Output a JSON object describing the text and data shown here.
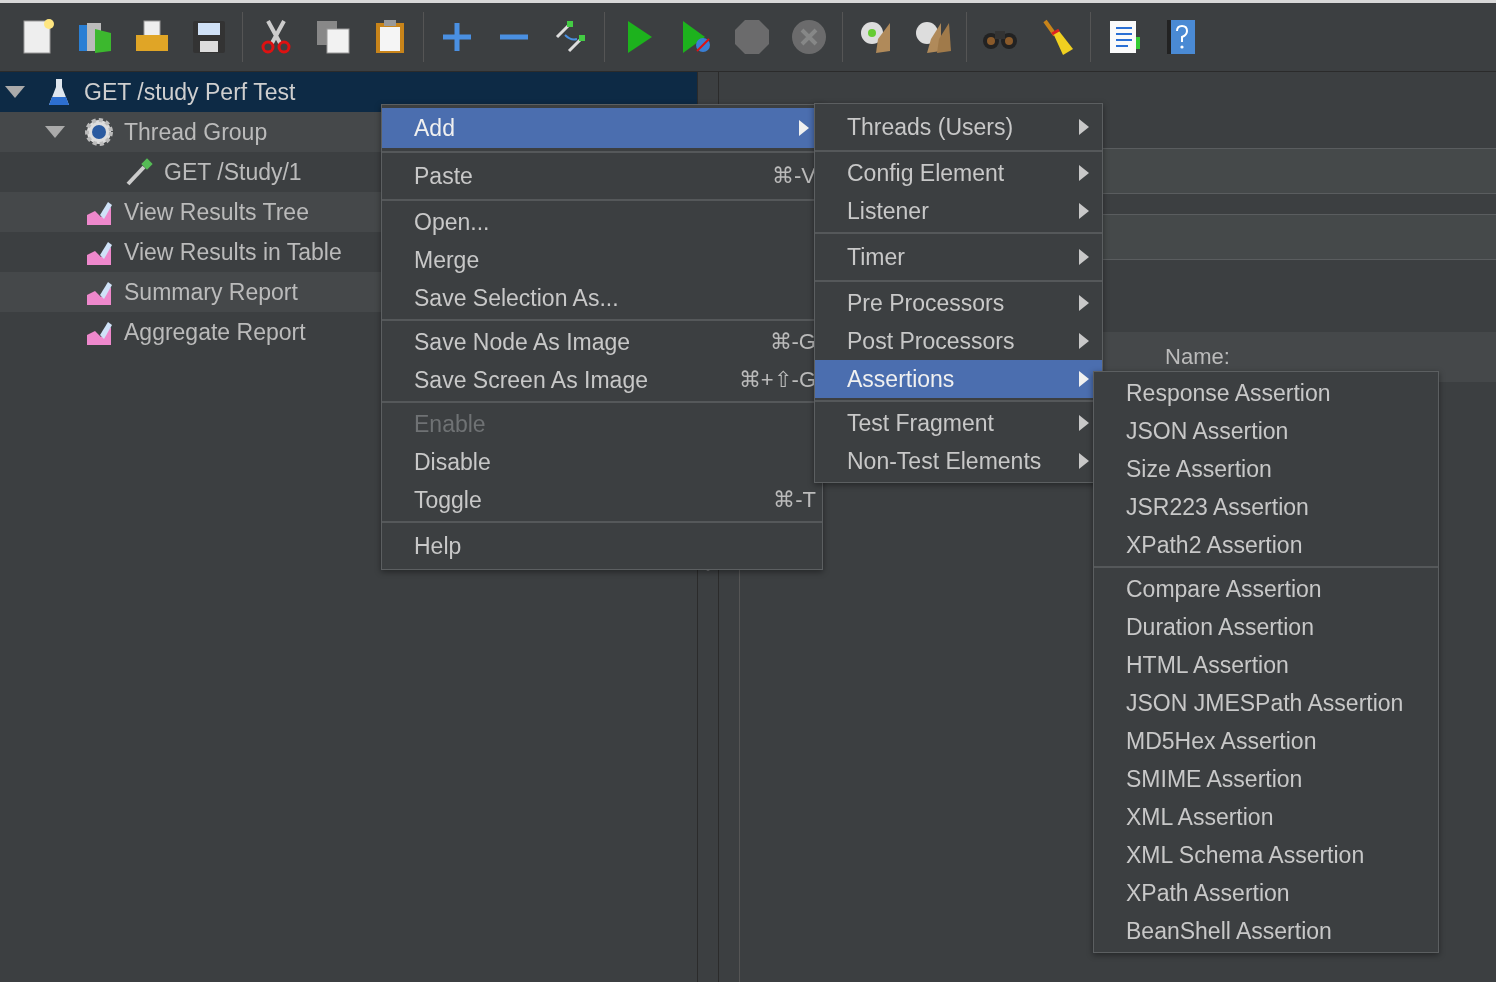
{
  "tree": [
    {
      "label": "GET /study Perf Test",
      "kind": "plan",
      "selected": true,
      "expanded": true,
      "children": [
        {
          "label": "Thread Group",
          "kind": "thread-group",
          "selected": false,
          "expanded": true,
          "children": [
            {
              "label": "GET /Study/1",
              "kind": "sampler",
              "selected": false
            }
          ]
        },
        {
          "label": "View Results Tree",
          "kind": "listener",
          "selected": false
        },
        {
          "label": "View Results in Table",
          "kind": "listener",
          "selected": false
        },
        {
          "label": "Summary Report",
          "kind": "listener",
          "selected": false
        },
        {
          "label": "Aggregate Report",
          "kind": "listener",
          "selected": false
        }
      ]
    }
  ],
  "editor": {
    "table_header": "Name:"
  },
  "context_menu": {
    "groups": [
      {
        "items": [
          {
            "label": "Add",
            "submenu": true,
            "selected": true,
            "disabled": false
          }
        ]
      },
      {
        "items": [
          {
            "label": "Paste",
            "shortcut": "⌘-V",
            "submenu": false,
            "selected": false,
            "disabled": false
          }
        ]
      },
      {
        "items": [
          {
            "label": "Open...",
            "submenu": false,
            "selected": false,
            "disabled": false
          },
          {
            "label": "Merge",
            "submenu": false,
            "selected": false,
            "disabled": false
          },
          {
            "label": "Save Selection As...",
            "submenu": false,
            "selected": false,
            "disabled": false
          }
        ]
      },
      {
        "items": [
          {
            "label": "Save Node As Image",
            "shortcut": "⌘-G",
            "submenu": false,
            "selected": false,
            "disabled": false
          },
          {
            "label": "Save Screen As Image",
            "shortcut": "⌘+⇧-G",
            "submenu": false,
            "selected": false,
            "disabled": false
          }
        ]
      },
      {
        "items": [
          {
            "label": "Enable",
            "submenu": false,
            "selected": false,
            "disabled": true
          },
          {
            "label": "Disable",
            "submenu": false,
            "selected": false,
            "disabled": false
          },
          {
            "label": "Toggle",
            "shortcut": "⌘-T",
            "submenu": false,
            "selected": false,
            "disabled": false
          }
        ]
      },
      {
        "items": [
          {
            "label": "Help",
            "submenu": false,
            "selected": false,
            "disabled": false
          }
        ]
      }
    ]
  },
  "add_submenu": {
    "groups": [
      {
        "items": [
          {
            "label": "Threads (Users)",
            "submenu": true,
            "selected": false,
            "disabled": false
          }
        ]
      },
      {
        "items": [
          {
            "label": "Config Element",
            "submenu": true,
            "selected": false,
            "disabled": false
          },
          {
            "label": "Listener",
            "submenu": true,
            "selected": false,
            "disabled": false
          }
        ]
      },
      {
        "items": [
          {
            "label": "Timer",
            "submenu": true,
            "selected": false,
            "disabled": false
          }
        ]
      },
      {
        "items": [
          {
            "label": "Pre Processors",
            "submenu": true,
            "selected": false,
            "disabled": false
          },
          {
            "label": "Post Processors",
            "submenu": true,
            "selected": false,
            "disabled": false
          },
          {
            "label": "Assertions",
            "submenu": true,
            "selected": true,
            "disabled": false
          }
        ]
      },
      {
        "items": [
          {
            "label": "Test Fragment",
            "submenu": true,
            "selected": false,
            "disabled": false
          },
          {
            "label": "Non-Test Elements",
            "submenu": true,
            "selected": false,
            "disabled": false
          }
        ]
      }
    ]
  },
  "assertions_submenu": {
    "groups": [
      {
        "items": [
          {
            "label": "Response Assertion",
            "submenu": false,
            "selected": false,
            "disabled": false
          },
          {
            "label": "JSON Assertion",
            "submenu": false,
            "selected": false,
            "disabled": false
          },
          {
            "label": "Size Assertion",
            "submenu": false,
            "selected": false,
            "disabled": false
          },
          {
            "label": "JSR223 Assertion",
            "submenu": false,
            "selected": false,
            "disabled": false
          },
          {
            "label": "XPath2 Assertion",
            "submenu": false,
            "selected": false,
            "disabled": false
          }
        ]
      },
      {
        "items": [
          {
            "label": "Compare Assertion",
            "submenu": false,
            "selected": false,
            "disabled": false
          },
          {
            "label": "Duration Assertion",
            "submenu": false,
            "selected": false,
            "disabled": false
          },
          {
            "label": "HTML Assertion",
            "submenu": false,
            "selected": false,
            "disabled": false
          },
          {
            "label": "JSON JMESPath Assertion",
            "submenu": false,
            "selected": false,
            "disabled": false
          },
          {
            "label": "MD5Hex Assertion",
            "submenu": false,
            "selected": false,
            "disabled": false
          },
          {
            "label": "SMIME Assertion",
            "submenu": false,
            "selected": false,
            "disabled": false
          },
          {
            "label": "XML Assertion",
            "submenu": false,
            "selected": false,
            "disabled": false
          },
          {
            "label": "XML Schema Assertion",
            "submenu": false,
            "selected": false,
            "disabled": false
          },
          {
            "label": "XPath Assertion",
            "submenu": false,
            "selected": false,
            "disabled": false
          },
          {
            "label": "BeanShell Assertion",
            "submenu": false,
            "selected": false,
            "disabled": false
          }
        ]
      }
    ]
  }
}
